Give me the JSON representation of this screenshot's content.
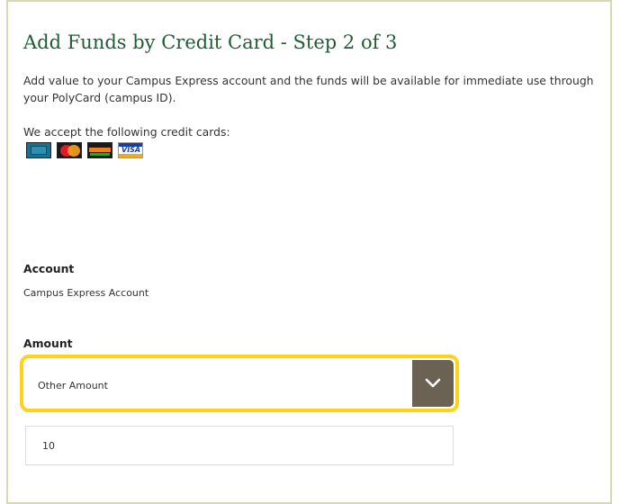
{
  "page": {
    "title": "Add Funds by Credit Card - Step 2 of 3",
    "intro": "Add value to your Campus Express account and the funds will be available for immediate use through your PolyCard (campus ID).",
    "accept_text": "We accept the following credit cards:"
  },
  "cards": [
    {
      "name": "American Express",
      "icon": "amex-card-icon"
    },
    {
      "name": "MasterCard",
      "icon": "mastercard-card-icon"
    },
    {
      "name": "Discover",
      "icon": "discover-card-icon"
    },
    {
      "name": "Visa",
      "icon": "visa-card-icon",
      "logo_text": "VISA"
    }
  ],
  "account": {
    "label": "Account",
    "value": "Campus Express Account"
  },
  "amount": {
    "label": "Amount",
    "selected": "Other Amount",
    "input_value": "10"
  },
  "colors": {
    "title": "#1f5e34",
    "highlight": "#ffd21a",
    "dropdown_button": "#6b6254",
    "frame_border": "#d8d8b4"
  }
}
